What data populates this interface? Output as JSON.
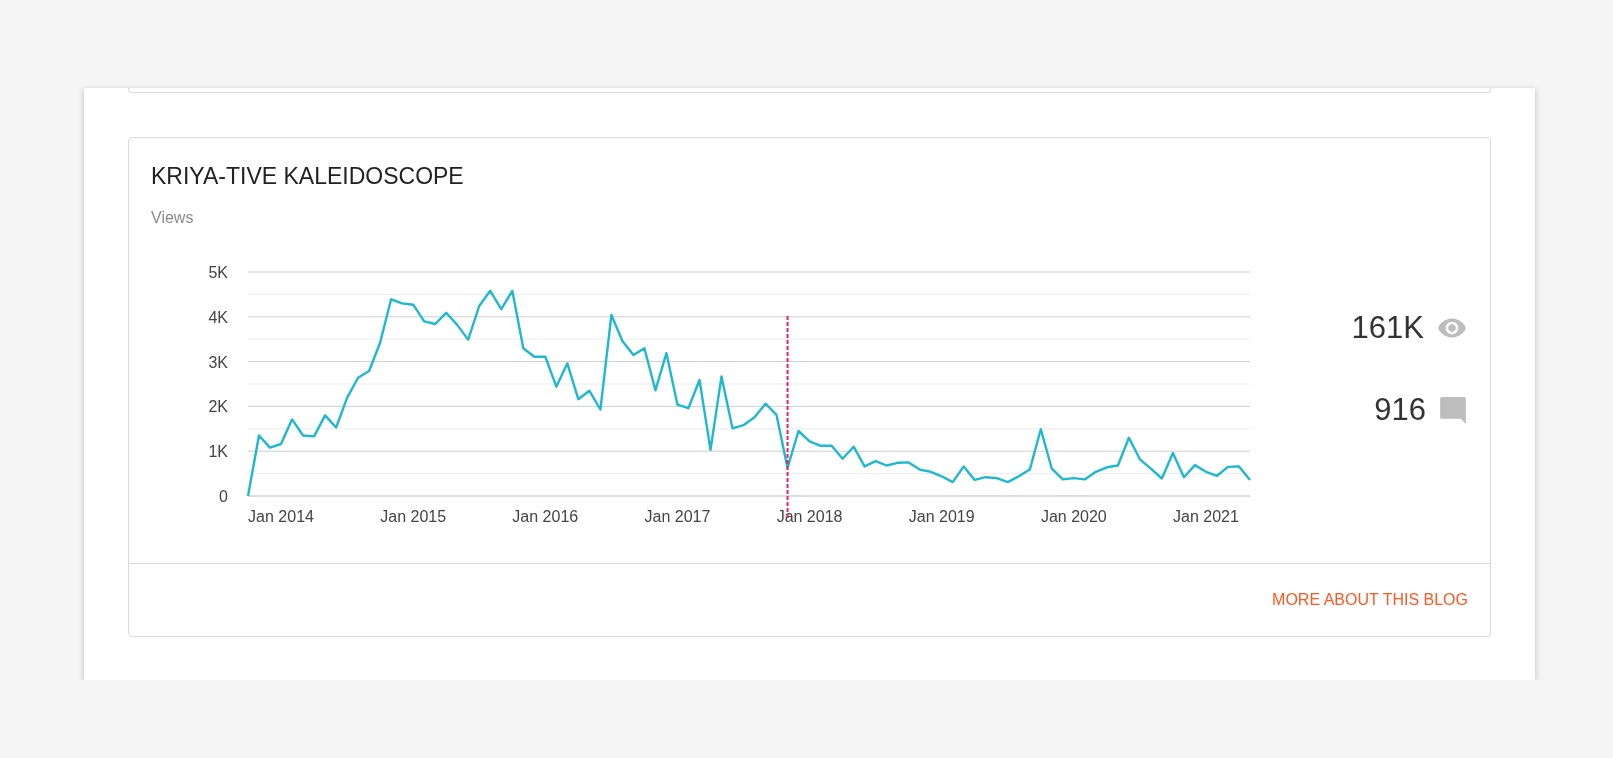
{
  "blog_card": {
    "title": "KRIYA-TIVE KALEIDOSCOPE",
    "chart_data": {
      "type": "line",
      "grid": true,
      "xlim": [
        "2013-10",
        "2021-05"
      ],
      "x": [
        "2013-10",
        "2013-11",
        "2013-12",
        "2014-01",
        "2014-02",
        "2014-03",
        "2014-04",
        "2014-05",
        "2014-06",
        "2014-07",
        "2014-08",
        "2014-09",
        "2014-10",
        "2014-11",
        "2014-12",
        "2015-01",
        "2015-02",
        "2015-03",
        "2015-04",
        "2015-05",
        "2015-06",
        "2015-07",
        "2015-08",
        "2015-09",
        "2015-10",
        "2015-11",
        "2015-12",
        "2016-01",
        "2016-02",
        "2016-03",
        "2016-04",
        "2016-05",
        "2016-06",
        "2016-07",
        "2016-08",
        "2016-09",
        "2016-10",
        "2016-11",
        "2016-12",
        "2017-01",
        "2017-02",
        "2017-03",
        "2017-04",
        "2017-05",
        "2017-06",
        "2017-07",
        "2017-08",
        "2017-09",
        "2017-10",
        "2017-11",
        "2017-12",
        "2018-01",
        "2018-02",
        "2018-03",
        "2018-04",
        "2018-05",
        "2018-06",
        "2018-07",
        "2018-08",
        "2018-09",
        "2018-10",
        "2018-11",
        "2018-12",
        "2019-01",
        "2019-02",
        "2019-03",
        "2019-04",
        "2019-05",
        "2019-06",
        "2019-07",
        "2019-08",
        "2019-09",
        "2019-10",
        "2019-11",
        "2019-12",
        "2020-01",
        "2020-02",
        "2020-03",
        "2020-04",
        "2020-05",
        "2020-06",
        "2020-07",
        "2020-08",
        "2020-09",
        "2020-10",
        "2020-11",
        "2020-12",
        "2021-01",
        "2021-02",
        "2021-03",
        "2021-04",
        "2021-05"
      ],
      "series": [
        {
          "name": "Views",
          "color": "#1eb8cf",
          "values": [
            0,
            1350,
            1080,
            1160,
            1710,
            1350,
            1330,
            1800,
            1530,
            2190,
            2640,
            2790,
            3420,
            4390,
            4300,
            4270,
            3900,
            3840,
            4090,
            3820,
            3490,
            4240,
            4580,
            4170,
            4580,
            3300,
            3110,
            3110,
            2440,
            2960,
            2160,
            2350,
            1930,
            4040,
            3460,
            3150,
            3300,
            2360,
            3190,
            2040,
            1960,
            2590,
            1030,
            2670,
            1510,
            1580,
            1760,
            2060,
            1810,
            630,
            1450,
            1220,
            1120,
            1120,
            830,
            1100,
            660,
            780,
            680,
            740,
            750,
            590,
            540,
            440,
            310,
            660,
            360,
            420,
            400,
            310,
            440,
            590,
            1490,
            610,
            370,
            400,
            370,
            540,
            640,
            680,
            1300,
            820,
            610,
            390,
            960,
            420,
            690,
            540,
            450,
            650,
            660,
            360
          ]
        }
      ],
      "ylim": [
        0,
        5000
      ],
      "yticks": [
        {
          "value": 0,
          "label": "0"
        },
        {
          "value": 1000,
          "label": "1K"
        },
        {
          "value": 2000,
          "label": "2K"
        },
        {
          "value": 3000,
          "label": "3K"
        },
        {
          "value": 4000,
          "label": "4K"
        },
        {
          "value": 5000,
          "label": "5K"
        }
      ],
      "xticks": [
        {
          "value": "2014-01",
          "label": "Jan 2014"
        },
        {
          "value": "2015-01",
          "label": "Jan 2015"
        },
        {
          "value": "2016-01",
          "label": "Jan 2016"
        },
        {
          "value": "2017-01",
          "label": "Jan 2017"
        },
        {
          "value": "2018-01",
          "label": "Jan 2018"
        },
        {
          "value": "2019-01",
          "label": "Jan 2019"
        },
        {
          "value": "2020-01",
          "label": "Jan 2020"
        },
        {
          "value": "2021-01",
          "label": "Jan 2021"
        }
      ],
      "ref_lines": [
        {
          "axis": "x",
          "value": "2017-11",
          "color": "#e91e63"
        }
      ]
    },
    "stats": [
      {
        "kind": "views",
        "value": "161K"
      },
      {
        "kind": "comments",
        "value": "916"
      }
    ],
    "footer_link": "MORE ABOUT THIS BLOG"
  }
}
